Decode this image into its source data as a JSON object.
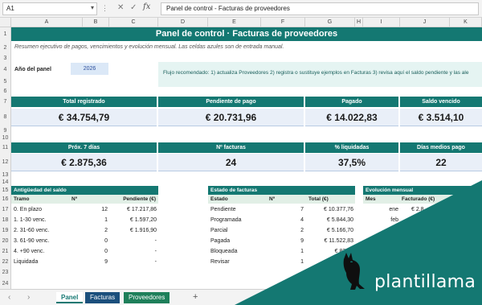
{
  "formula_bar": {
    "name_box": "A1",
    "formula": "Panel de control - Facturas de proveedores",
    "fx": "fx"
  },
  "columns": [
    "A",
    "B",
    "C",
    "D",
    "E",
    "F",
    "G",
    "H",
    "I",
    "J",
    "K"
  ],
  "rows": [
    "1",
    "2",
    "3",
    "4",
    "5",
    "6",
    "7",
    "8",
    "9",
    "10",
    "11",
    "12",
    "13",
    "14",
    "15",
    "16",
    "17",
    "18",
    "19",
    "20",
    "21",
    "22",
    "23",
    "24"
  ],
  "sheet": {
    "title": "Panel de control · Facturas de proveedores",
    "subtitle": "Resumen ejecutivo de pagos, vencimientos y evolución mensual. Las celdas azules son de entrada manual.",
    "year_label": "Año del panel",
    "year_value": "2026",
    "flow_note": "Flujo recomendado: 1) actualiza Proveedores  2) registra o sustituye ejemplos en Facturas  3) revisa aquí el saldo pendiente y las ale",
    "kpis_row1": [
      {
        "label": "Total registrado",
        "value": "€ 34.754,79"
      },
      {
        "label": "Pendiente de pago",
        "value": "€ 20.731,96"
      },
      {
        "label": "Pagado",
        "value": "€ 14.022,83"
      },
      {
        "label": "Saldo vencido",
        "value": "€ 3.514,10"
      }
    ],
    "kpis_row2": [
      {
        "label": "Próx. 7 días",
        "value": "€ 2.875,36"
      },
      {
        "label": "Nº facturas",
        "value": "24"
      },
      {
        "label": "% liquidadas",
        "value": "37,5%"
      },
      {
        "label": "Días medios pago",
        "value": "22"
      }
    ],
    "aging": {
      "title": "Antigüedad del saldo",
      "headers": [
        "Tramo",
        "Nº",
        "Pendiente (€)"
      ],
      "rows": [
        [
          "0. En plazo",
          "12",
          "€ 17.217,86"
        ],
        [
          "1. 1-30 venc.",
          "1",
          "€ 1.597,20"
        ],
        [
          "2. 31-60 venc.",
          "2",
          "€ 1.916,90"
        ],
        [
          "3. 61-90 venc.",
          "0",
          "-"
        ],
        [
          "4. +90 venc.",
          "0",
          "-"
        ],
        [
          "Liquidada",
          "9",
          "-"
        ]
      ]
    },
    "status": {
      "title": "Estado de facturas",
      "headers": [
        "Estado",
        "Nº",
        "Total (€)"
      ],
      "rows": [
        [
          "Pendiente",
          "7",
          "€ 10.377,76"
        ],
        [
          "Programada",
          "4",
          "€ 5.844,30"
        ],
        [
          "Parcial",
          "2",
          "€ 5.166,70"
        ],
        [
          "Pagada",
          "9",
          "€ 11.522,83"
        ],
        [
          "Bloqueada",
          "1",
          "€ 826,8"
        ],
        [
          "Revisar",
          "1",
          ""
        ]
      ]
    },
    "monthly": {
      "title": "Evolución mensual",
      "headers": [
        "Mes",
        "Facturado (€)"
      ],
      "rows": [
        [
          "ene",
          "€ 2.8"
        ],
        [
          "feb",
          ""
        ]
      ]
    }
  },
  "sheet_tabs": [
    "Panel",
    "Facturas",
    "Proveedores"
  ],
  "add_sheet": "+",
  "brand": {
    "name": "plantillama",
    "color": "#147872"
  }
}
